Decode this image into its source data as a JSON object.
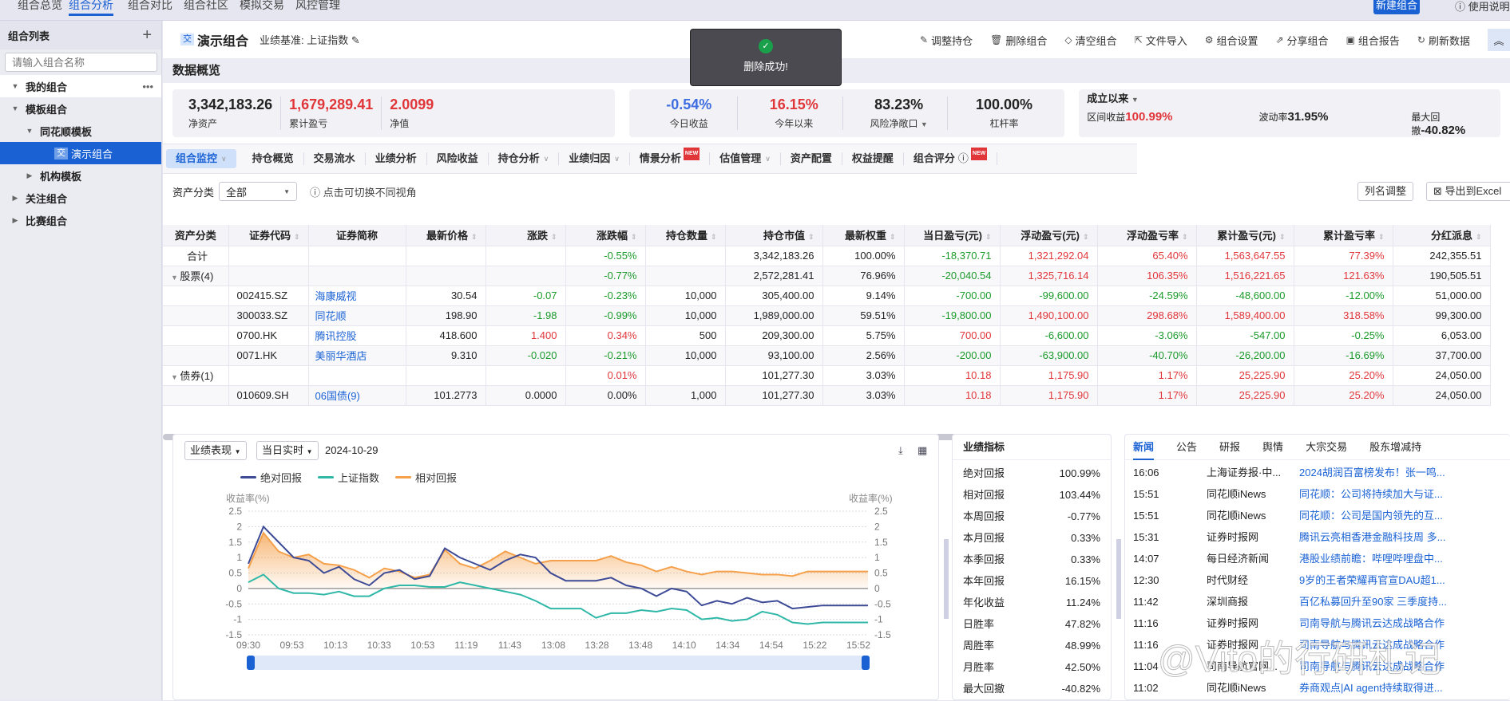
{
  "topnav": {
    "tabs": [
      "组合总览",
      "组合分析",
      "组合对比",
      "组合社区",
      "模拟交易",
      "风控管理"
    ],
    "active": 1,
    "new_button": "新建组合",
    "help": "使用说明"
  },
  "sidebar": {
    "title": "组合列表",
    "add_icon": "plus-icon",
    "search_placeholder": "请输入组合名称",
    "items": [
      {
        "label": "我的组合",
        "level": 0,
        "state": "expanded"
      },
      {
        "label": "模板组合",
        "level": 0,
        "state": "expanded"
      },
      {
        "label": "同花顺模板",
        "level": 1,
        "state": "expanded"
      },
      {
        "label": "演示组合",
        "level": 2,
        "state": "selected",
        "badge": "交"
      },
      {
        "label": "机构模板",
        "level": 1,
        "state": "collapsed"
      },
      {
        "label": "关注组合",
        "level": 0,
        "state": "collapsed"
      },
      {
        "label": "比赛组合",
        "level": 0,
        "state": "collapsed"
      }
    ]
  },
  "header": {
    "badge": "交",
    "title": "演示组合",
    "benchmark_label": "业绩基准:",
    "benchmark_value": "上证指数",
    "tools": [
      {
        "label": "调整持仓",
        "icon": "pencil-icon"
      },
      {
        "label": "删除组合",
        "icon": "trash-icon"
      },
      {
        "label": "清空组合",
        "icon": "eraser-icon"
      },
      {
        "label": "文件导入",
        "icon": "import-icon"
      },
      {
        "label": "组合设置",
        "icon": "gear-icon"
      },
      {
        "label": "分享组合",
        "icon": "share-icon"
      },
      {
        "label": "组合报告",
        "icon": "report-icon"
      },
      {
        "label": "刷新数据",
        "icon": "refresh-icon"
      }
    ]
  },
  "toast": {
    "message": "删除成功!",
    "icon": "check-circle-icon"
  },
  "overview": {
    "title": "数据概览",
    "card1": [
      {
        "value": "3,342,183.26",
        "label": "净资产",
        "color": "dark"
      },
      {
        "value": "1,679,289.41",
        "label": "累计盈亏",
        "color": "red"
      },
      {
        "value": "2.0099",
        "label": "净值",
        "color": "red"
      }
    ],
    "card2": [
      {
        "value": "-0.54%",
        "label": "今日收益",
        "color": "blue"
      },
      {
        "value": "16.15%",
        "label": "今年以来",
        "color": "red"
      },
      {
        "value": "83.23%",
        "label": "风险净敞口",
        "color": "dark",
        "dropdown": true
      },
      {
        "value": "100.00%",
        "label": "杠杆率",
        "color": "dark"
      }
    ],
    "card3": {
      "period": "成立以来",
      "stats": [
        {
          "label": "区间收益",
          "value": "100.99%",
          "color": "red"
        },
        {
          "label": "波动率",
          "value": "31.95%",
          "color": "dark"
        },
        {
          "label": "最大回撤",
          "value": "-40.82%",
          "color": "dark"
        }
      ]
    }
  },
  "subtabs": [
    {
      "label": "组合监控",
      "chevron": true,
      "active": true
    },
    {
      "label": "持仓概览"
    },
    {
      "label": "交易流水"
    },
    {
      "label": "业绩分析"
    },
    {
      "label": "风险收益"
    },
    {
      "label": "持仓分析",
      "chevron": true
    },
    {
      "label": "业绩归因",
      "chevron": true
    },
    {
      "label": "情景分析",
      "new": true
    },
    {
      "label": "估值管理",
      "chevron": true
    },
    {
      "label": "资产配置"
    },
    {
      "label": "权益提醒"
    },
    {
      "label": "组合评分",
      "info": true,
      "new": true
    }
  ],
  "new_badge": "NEW",
  "filter": {
    "label": "资产分类",
    "value": "全部",
    "hint": "点击可切换不同视角",
    "col_adjust": "列名调整",
    "export": "导出到Excel"
  },
  "table": {
    "columns": [
      "资产分类",
      "证券代码",
      "证券简称",
      "最新价格",
      "涨跌",
      "涨跌幅",
      "持仓数量",
      "持仓市值",
      "最新权重",
      "当日盈亏(元)",
      "浮动盈亏(元)",
      "浮动盈亏率",
      "累计盈亏(元)",
      "累计盈亏率",
      "分红派息"
    ],
    "rows": [
      {
        "type": "total",
        "cat": "合计",
        "code": "",
        "name": "",
        "price": "",
        "chg": "",
        "pct": "-0.55%",
        "qty": "",
        "mv": "3,342,183.26",
        "w": "100.00%",
        "day": "-18,370.71",
        "fl": "1,321,292.04",
        "flr": "65.40%",
        "cum": "1,563,647.55",
        "cumr": "77.39%",
        "div": "242,355.51"
      },
      {
        "type": "group",
        "cat": "股票(4)",
        "code": "",
        "name": "",
        "price": "",
        "chg": "",
        "pct": "-0.77%",
        "qty": "",
        "mv": "2,572,281.41",
        "w": "76.96%",
        "day": "-20,040.54",
        "fl": "1,325,716.14",
        "flr": "106.35%",
        "cum": "1,516,221.65",
        "cumr": "121.63%",
        "div": "190,505.51"
      },
      {
        "type": "item",
        "cat": "",
        "code": "002415.SZ",
        "name": "海康威视",
        "price": "30.54",
        "chg": "-0.07",
        "pct": "-0.23%",
        "qty": "10,000",
        "mv": "305,400.00",
        "w": "9.14%",
        "day": "-700.00",
        "fl": "-99,600.00",
        "flr": "-24.59%",
        "cum": "-48,600.00",
        "cumr": "-12.00%",
        "div": "51,000.00"
      },
      {
        "type": "item",
        "cat": "",
        "code": "300033.SZ",
        "name": "同花顺",
        "price": "198.90",
        "chg": "-1.98",
        "pct": "-0.99%",
        "qty": "10,000",
        "mv": "1,989,000.00",
        "w": "59.51%",
        "day": "-19,800.00",
        "fl": "1,490,100.00",
        "flr": "298.68%",
        "cum": "1,589,400.00",
        "cumr": "318.58%",
        "div": "99,300.00"
      },
      {
        "type": "item",
        "cat": "",
        "code": "0700.HK",
        "name": "腾讯控股",
        "price": "418.600",
        "chg": "1.400",
        "pct": "0.34%",
        "qty": "500",
        "mv": "209,300.00",
        "w": "5.75%",
        "day": "700.00",
        "fl": "-6,600.00",
        "flr": "-3.06%",
        "cum": "-547.00",
        "cumr": "-0.25%",
        "div": "6,053.00"
      },
      {
        "type": "item",
        "cat": "",
        "code": "0071.HK",
        "name": "美丽华酒店",
        "price": "9.310",
        "chg": "-0.020",
        "pct": "-0.21%",
        "qty": "10,000",
        "mv": "93,100.00",
        "w": "2.56%",
        "day": "-200.00",
        "fl": "-63,900.00",
        "flr": "-40.70%",
        "cum": "-26,200.00",
        "cumr": "-16.69%",
        "div": "37,700.00"
      },
      {
        "type": "group",
        "cat": "债券(1)",
        "code": "",
        "name": "",
        "price": "",
        "chg": "",
        "pct": "0.01%",
        "qty": "",
        "mv": "101,277.30",
        "w": "3.03%",
        "day": "10.18",
        "fl": "1,175.90",
        "flr": "1.17%",
        "cum": "25,225.90",
        "cumr": "25.20%",
        "div": "24,050.00"
      },
      {
        "type": "item",
        "cat": "",
        "code": "010609.SH",
        "name": "06国债(9)",
        "price": "101.2773",
        "chg": "0.0000",
        "pct": "0.00%",
        "qty": "1,000",
        "mv": "101,277.30",
        "w": "3.03%",
        "day": "10.18",
        "fl": "1,175.90",
        "flr": "1.17%",
        "cum": "25,225.90",
        "cumr": "25.20%",
        "div": "24,050.00"
      }
    ]
  },
  "chart_panel": {
    "select1": "业绩表现",
    "select2": "当日实时",
    "date": "2024-10-29",
    "download_icon": "download-icon",
    "table_icon": "table-icon"
  },
  "chart_data": {
    "type": "line",
    "title": "",
    "ylabel": "收益率(%)",
    "ylabel_right": "收益率(%)",
    "ylim": [
      -1.5,
      2.5
    ],
    "yticks": [
      "2.5",
      "2",
      "1.5",
      "1",
      "0.5",
      "0",
      "-0.5",
      "-1",
      "-1.5"
    ],
    "xticks": [
      "09:30",
      "09:53",
      "10:13",
      "10:33",
      "10:53",
      "11:19",
      "11:43",
      "13:08",
      "13:28",
      "13:48",
      "14:10",
      "14:34",
      "14:54",
      "15:22",
      "15:52"
    ],
    "grid": true,
    "legend_position": "top-left",
    "series": [
      {
        "name": "绝对回报",
        "color": "#3d4a96",
        "values": [
          0.8,
          2.0,
          1.5,
          1.0,
          0.9,
          0.5,
          0.7,
          0.3,
          0.1,
          0.5,
          0.6,
          0.3,
          0.4,
          1.3,
          1.0,
          0.8,
          0.6,
          0.9,
          1.1,
          1.0,
          0.5,
          0.25,
          0.25,
          0.25,
          0.35,
          0.1,
          0.0,
          -0.25,
          0.0,
          -0.1,
          -0.55,
          -0.4,
          -0.5,
          -0.3,
          -0.45,
          -0.4,
          -0.65,
          -0.6,
          -0.55,
          -0.55,
          -0.55,
          -0.55
        ]
      },
      {
        "name": "上证指数",
        "color": "#2fb8a8",
        "values": [
          0.2,
          0.45,
          0.0,
          -0.15,
          -0.15,
          -0.2,
          -0.1,
          -0.25,
          -0.25,
          0.0,
          0.1,
          0.1,
          0.05,
          0.05,
          0.2,
          0.1,
          0.0,
          -0.1,
          -0.2,
          -0.4,
          -0.65,
          -0.65,
          -0.65,
          -0.95,
          -0.8,
          -0.8,
          -0.7,
          -0.75,
          -0.65,
          -0.7,
          -1.0,
          -0.95,
          -1.05,
          -1.0,
          -0.75,
          -0.85,
          -1.1,
          -1.15,
          -1.1,
          -1.1,
          -1.1,
          -1.1
        ]
      },
      {
        "name": "相对回报",
        "color": "#f5a04a",
        "values": [
          0.65,
          1.8,
          1.2,
          1.0,
          1.1,
          0.8,
          0.75,
          0.6,
          0.35,
          0.65,
          0.55,
          0.35,
          0.45,
          1.25,
          0.8,
          0.65,
          0.9,
          1.2,
          1.0,
          0.8,
          0.9,
          0.9,
          0.9,
          0.9,
          1.05,
          0.85,
          0.75,
          0.55,
          0.7,
          0.55,
          0.45,
          0.55,
          0.55,
          0.5,
          0.45,
          0.45,
          0.4,
          0.55,
          0.55,
          0.55,
          0.55,
          0.55
        ]
      }
    ]
  },
  "metrics": {
    "title": "业绩指标",
    "rows": [
      {
        "label": "绝对回报",
        "value": "100.99%"
      },
      {
        "label": "相对回报",
        "value": "103.44%"
      },
      {
        "label": "本周回报",
        "value": "-0.77%"
      },
      {
        "label": "本月回报",
        "value": "0.33%"
      },
      {
        "label": "本季回报",
        "value": "0.33%"
      },
      {
        "label": "本年回报",
        "value": "16.15%"
      },
      {
        "label": "年化收益",
        "value": "11.24%"
      },
      {
        "label": "日胜率",
        "value": "47.82%"
      },
      {
        "label": "周胜率",
        "value": "48.99%"
      },
      {
        "label": "月胜率",
        "value": "42.50%"
      },
      {
        "label": "最大回撤",
        "value": "-40.82%"
      }
    ]
  },
  "news": {
    "tabs": [
      "新闻",
      "公告",
      "研报",
      "舆情",
      "大宗交易",
      "股东增减持"
    ],
    "active": 0,
    "items": [
      {
        "time": "16:06",
        "source": "上海证券报·中...",
        "title": "2024胡润百富榜发布！张一鸣..."
      },
      {
        "time": "15:51",
        "source": "同花顺iNews",
        "title": "同花顺：公司将持续加大与证..."
      },
      {
        "time": "15:51",
        "source": "同花顺iNews",
        "title": "同花顺：公司是国内领先的互..."
      },
      {
        "time": "15:31",
        "source": "证券时报网",
        "title": "腾讯云亮相香港金融科技周 多..."
      },
      {
        "time": "14:07",
        "source": "每日经济新闻",
        "title": "港股业绩前瞻：哔哩哔哩盘中..."
      },
      {
        "time": "12:30",
        "source": "时代财经",
        "title": "9岁的王者荣耀再官宣DAU超1..."
      },
      {
        "time": "11:42",
        "source": "深圳商报",
        "title": "百亿私募回升至90家 三季度持..."
      },
      {
        "time": "11:16",
        "source": "证券时报网",
        "title": "司南导航与腾讯云达成战略合作"
      },
      {
        "time": "11:16",
        "source": "证券时报网",
        "title": "司南导航与腾讯云达成战略合作"
      },
      {
        "time": "11:04",
        "source": "司南导航官网...",
        "title": "司南导航与腾讯云达成战略合作"
      },
      {
        "time": "11:02",
        "source": "同花顺iNews",
        "title": "券商观点|AI agent持续取得进..."
      }
    ]
  },
  "watermark": "@Vito的行研札记"
}
